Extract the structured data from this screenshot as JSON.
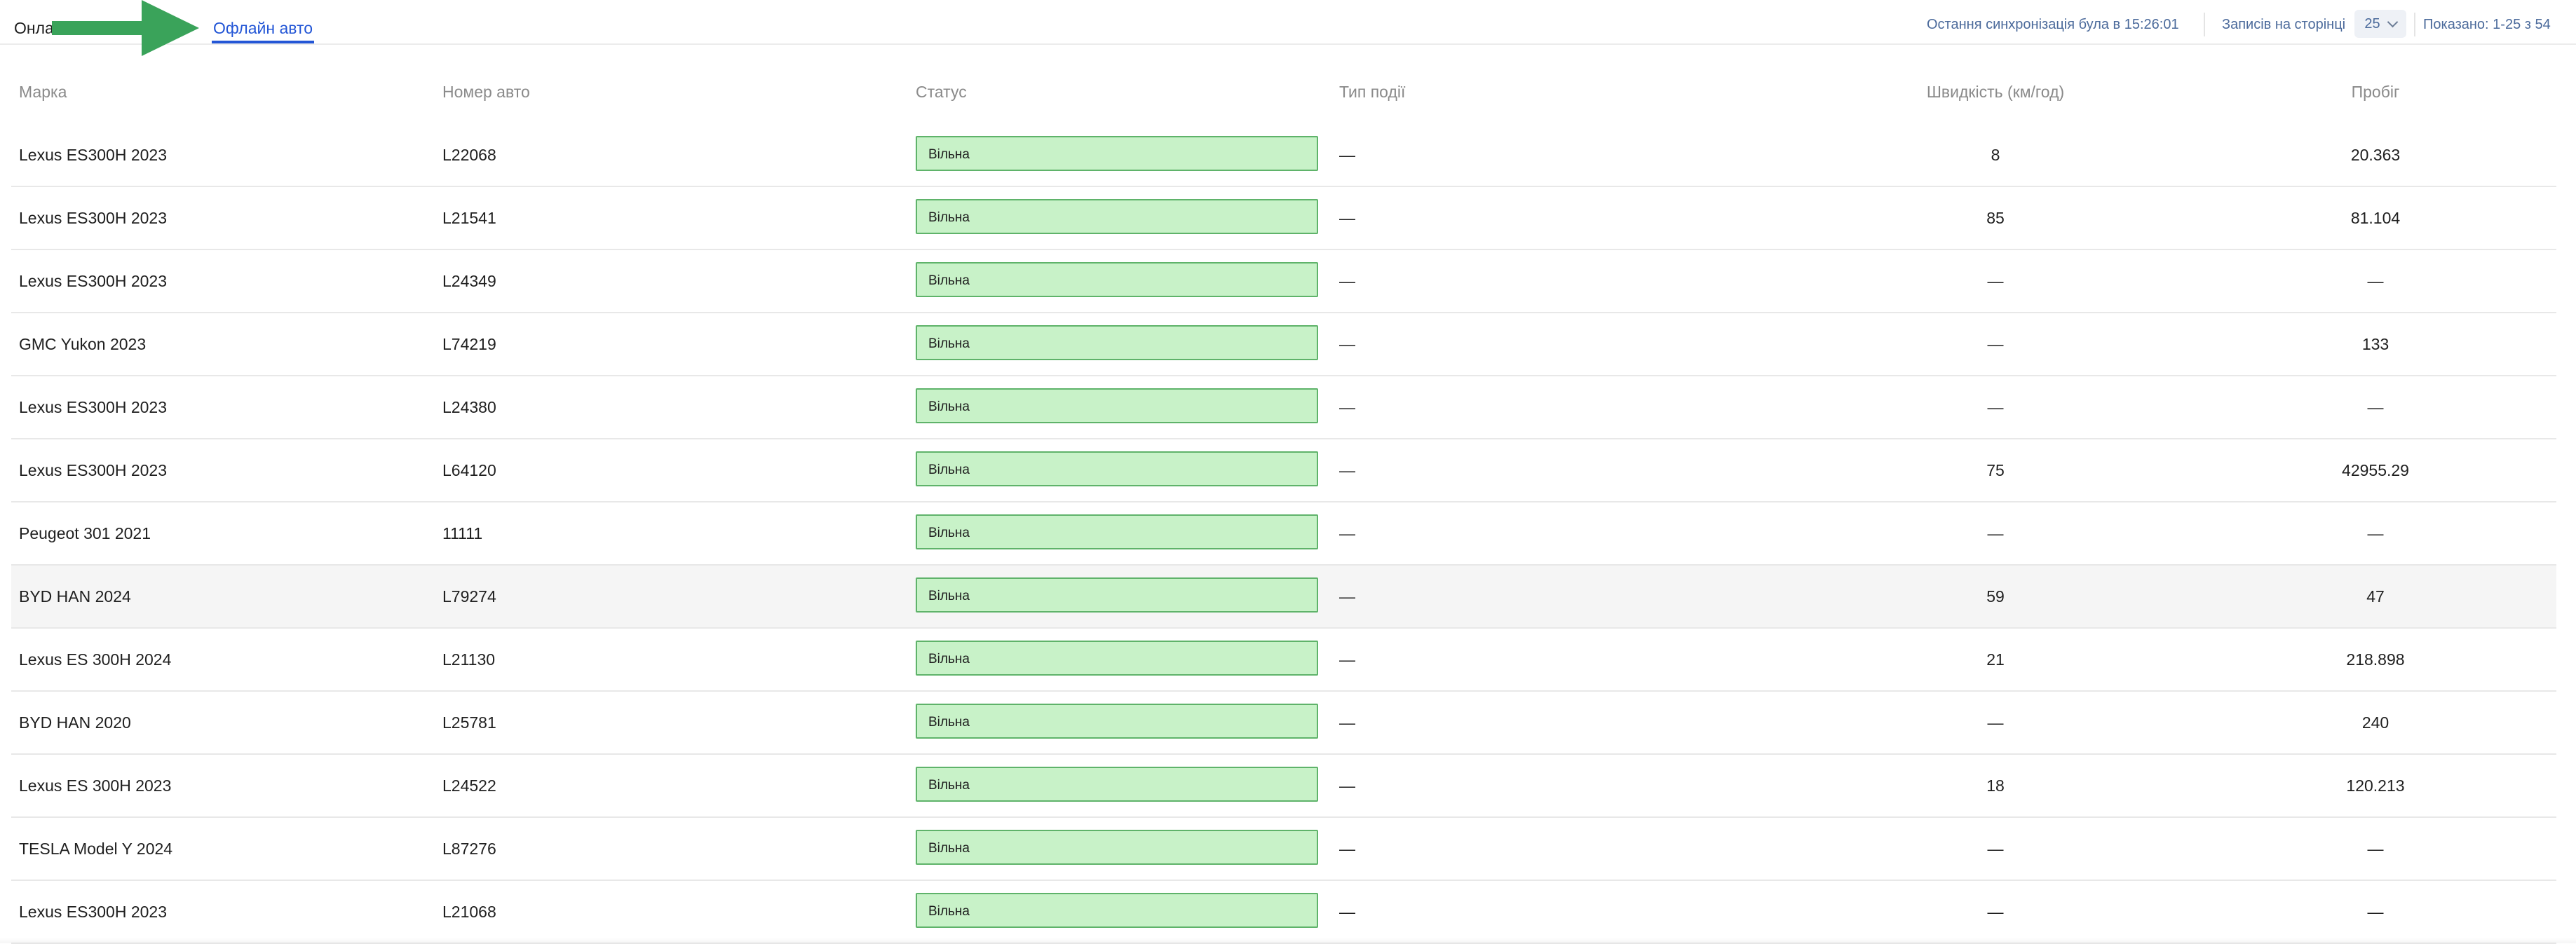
{
  "tabs": {
    "online": "Онлайн авто",
    "offline": "Офлайн авто"
  },
  "header": {
    "sync_text": "Остання синхронізація була в 15:26:01",
    "per_page_label": "Записів на сторінці",
    "per_page_value": "25",
    "shown_text": "Показано: 1-25 з 54"
  },
  "colors": {
    "accent": "#2356d6",
    "status_bg": "#c8f2c8",
    "status_border": "#5fb36a",
    "arrow": "#3aa35a"
  },
  "icons": {
    "arrow": "green-arrow-icon",
    "dropdown": "chevron-down-icon"
  },
  "table": {
    "columns": [
      "Марка",
      "Номер авто",
      "Статус",
      "Тип події",
      "Швидкість (км/год)",
      "Пробіг"
    ],
    "rows": [
      {
        "brand": "Lexus ES300H 2023",
        "plate": "L22068",
        "status": "Вільна",
        "event": "—",
        "speed": "8",
        "mileage": "20.363"
      },
      {
        "brand": "Lexus ES300H 2023",
        "plate": "L21541",
        "status": "Вільна",
        "event": "—",
        "speed": "85",
        "mileage": "81.104"
      },
      {
        "brand": "Lexus ES300H 2023",
        "plate": "L24349",
        "status": "Вільна",
        "event": "—",
        "speed": "—",
        "mileage": "—"
      },
      {
        "brand": "GMC Yukon 2023",
        "plate": "L74219",
        "status": "Вільна",
        "event": "—",
        "speed": "—",
        "mileage": "133"
      },
      {
        "brand": "Lexus ES300H 2023",
        "plate": "L24380",
        "status": "Вільна",
        "event": "—",
        "speed": "—",
        "mileage": "—"
      },
      {
        "brand": "Lexus ES300H 2023",
        "plate": "L64120",
        "status": "Вільна",
        "event": "—",
        "speed": "75",
        "mileage": "42955.29"
      },
      {
        "brand": "Peugeot 301 2021",
        "plate": "11111",
        "status": "Вільна",
        "event": "—",
        "speed": "—",
        "mileage": "—"
      },
      {
        "brand": "BYD HAN 2024",
        "plate": "L79274",
        "status": "Вільна",
        "event": "—",
        "speed": "59",
        "mileage": "47"
      },
      {
        "brand": "Lexus ES 300H 2024",
        "plate": "L21130",
        "status": "Вільна",
        "event": "—",
        "speed": "21",
        "mileage": "218.898"
      },
      {
        "brand": "BYD HAN 2020",
        "plate": "L25781",
        "status": "Вільна",
        "event": "—",
        "speed": "—",
        "mileage": "240"
      },
      {
        "brand": "Lexus ES 300H 2023",
        "plate": "L24522",
        "status": "Вільна",
        "event": "—",
        "speed": "18",
        "mileage": "120.213"
      },
      {
        "brand": "TESLA Model Y 2024",
        "plate": "L87276",
        "status": "Вільна",
        "event": "—",
        "speed": "—",
        "mileage": "—"
      },
      {
        "brand": "Lexus ES300H 2023",
        "plate": "L21068",
        "status": "Вільна",
        "event": "—",
        "speed": "—",
        "mileage": "—"
      }
    ]
  }
}
